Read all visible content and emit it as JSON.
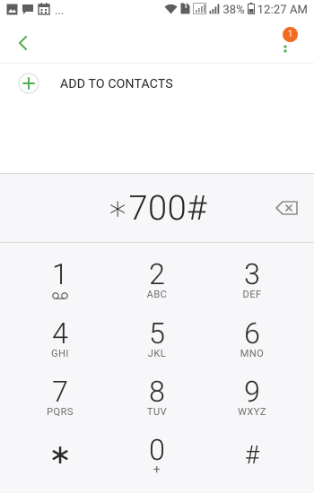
{
  "status_bar": {
    "left_icons": [
      "gallery-icon",
      "message-icon",
      "calendar-icon"
    ],
    "overflow": "...",
    "right_icons": [
      "wifi-icon",
      "sim-badge-icon",
      "signal-icon",
      "battery-icon"
    ],
    "sim_label": "1",
    "battery": "38%",
    "time": "12:27 AM"
  },
  "actionbar": {
    "back_icon": "back-arrow-icon",
    "more_icon": "more-vertical-icon",
    "badge_count": "1",
    "accent_color": "#4caf50",
    "badge_color": "#f36b20"
  },
  "add_contacts": {
    "icon": "add-circle-icon",
    "label": "ADD TO CONTACTS"
  },
  "dial_entry": {
    "number": "∗700#",
    "backspace_icon": "backspace-icon"
  },
  "keypad": {
    "keys": [
      {
        "digit": "1",
        "letters": "",
        "icon": "voicemail-icon"
      },
      {
        "digit": "2",
        "letters": "ABC"
      },
      {
        "digit": "3",
        "letters": "DEF"
      },
      {
        "digit": "4",
        "letters": "GHI"
      },
      {
        "digit": "5",
        "letters": "JKL"
      },
      {
        "digit": "6",
        "letters": "MNO"
      },
      {
        "digit": "7",
        "letters": "PQRS"
      },
      {
        "digit": "8",
        "letters": "TUV"
      },
      {
        "digit": "9",
        "letters": "WXYZ"
      },
      {
        "digit": "∗",
        "letters": ""
      },
      {
        "digit": "0",
        "letters": "+"
      },
      {
        "digit": "#",
        "letters": ""
      }
    ]
  }
}
